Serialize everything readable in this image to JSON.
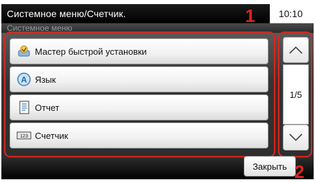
{
  "header": {
    "title": "Системное меню/Счетчик.",
    "time": "10:10",
    "subtitle": "Системное меню"
  },
  "menu": {
    "items": [
      {
        "label": "Мастер быстрой установки",
        "icon": "quick-setup-wizard-icon"
      },
      {
        "label": "Язык",
        "icon": "language-icon"
      },
      {
        "label": "Отчет",
        "icon": "report-icon"
      },
      {
        "label": "Счетчик",
        "icon": "counter-icon"
      }
    ]
  },
  "scroll": {
    "page_indicator": "1/5",
    "up_icon": "chevron-up-icon",
    "down_icon": "chevron-down-icon"
  },
  "footer": {
    "close_label": "Закрыть"
  },
  "callouts": [
    "1",
    "2"
  ],
  "colors": {
    "callout_red": "#d9261c",
    "title_bar": "#000000"
  }
}
